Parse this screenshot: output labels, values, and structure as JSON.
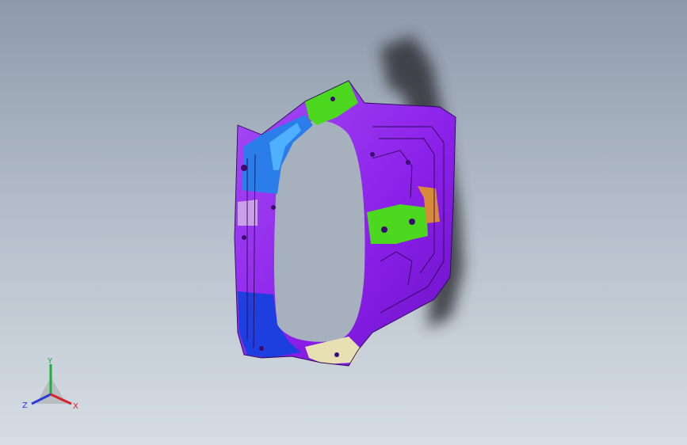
{
  "viewport": {
    "model_colors": {
      "frame": "#8a1fe8",
      "frame_dark": "#5a0fa8",
      "frame_light": "#a64cf5",
      "blue_region": "#2b7de9",
      "blue_light": "#4fb0ff",
      "deep_blue": "#1e3fe0",
      "green_part": "#4bd81e",
      "orange_part": "#d88a3a",
      "beige_part": "#e6e0b2",
      "pink_patch": "#c9a0e8",
      "shadow": "#303338"
    }
  },
  "triad": {
    "labels": {
      "y": "Y",
      "z": "Z",
      "x": "X"
    },
    "colors": {
      "y": "#1fae3a",
      "z": "#2a3cd8",
      "x": "#d8222a"
    }
  }
}
